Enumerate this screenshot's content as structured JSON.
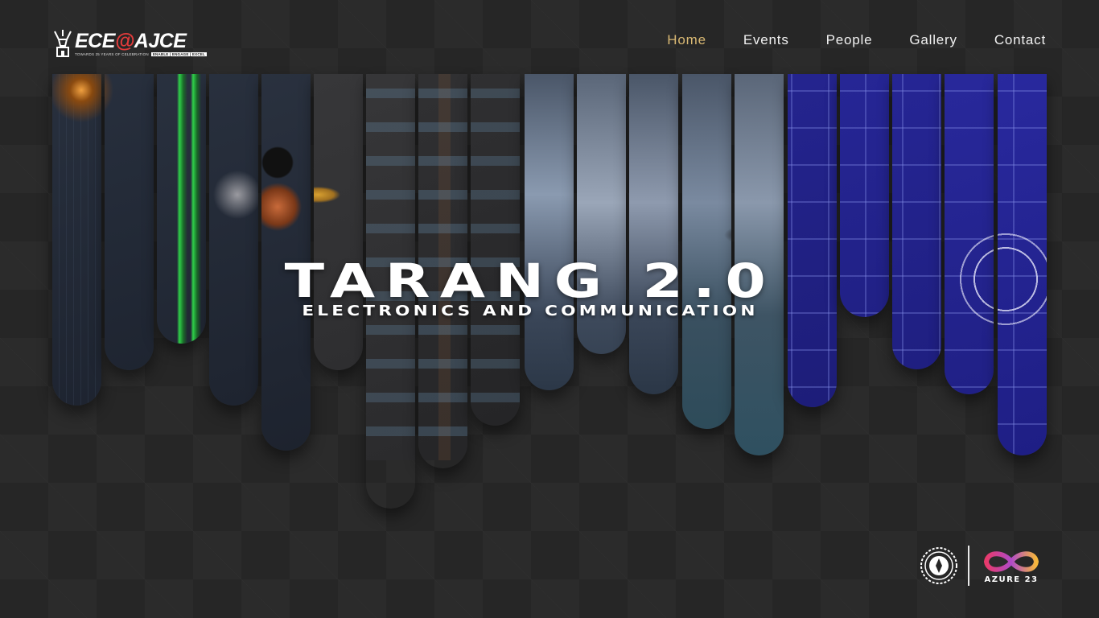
{
  "header": {
    "logo": {
      "main_prefix": "ECE",
      "main_at": "@",
      "main_suffix": "AJCE",
      "tagline": "TOWARDS 25 YEARS OF CELEBRATION",
      "tagline_box": "ENABLE | ENGAGE | EXCEL",
      "icon": "antenna-tower-icon"
    },
    "nav": [
      {
        "label": "Home",
        "active": true
      },
      {
        "label": "Events",
        "active": false
      },
      {
        "label": "People",
        "active": false
      },
      {
        "label": "Gallery",
        "active": false
      },
      {
        "label": "Contact",
        "active": false
      }
    ]
  },
  "hero": {
    "title": "TARANG 2.0",
    "subtitle": "ELECTRONICS AND COMMUNICATION"
  },
  "footer": {
    "seal_icon": "college-seal-icon",
    "azure_label": "AZURE 23",
    "azure_icon": "infinity-logo-icon"
  },
  "colors": {
    "background": "#262626",
    "nav_active": "#d8b873",
    "logo_accent": "#e23b3b",
    "azure_gradient_start": "#e83a6b",
    "azure_gradient_end": "#f5b73b"
  }
}
